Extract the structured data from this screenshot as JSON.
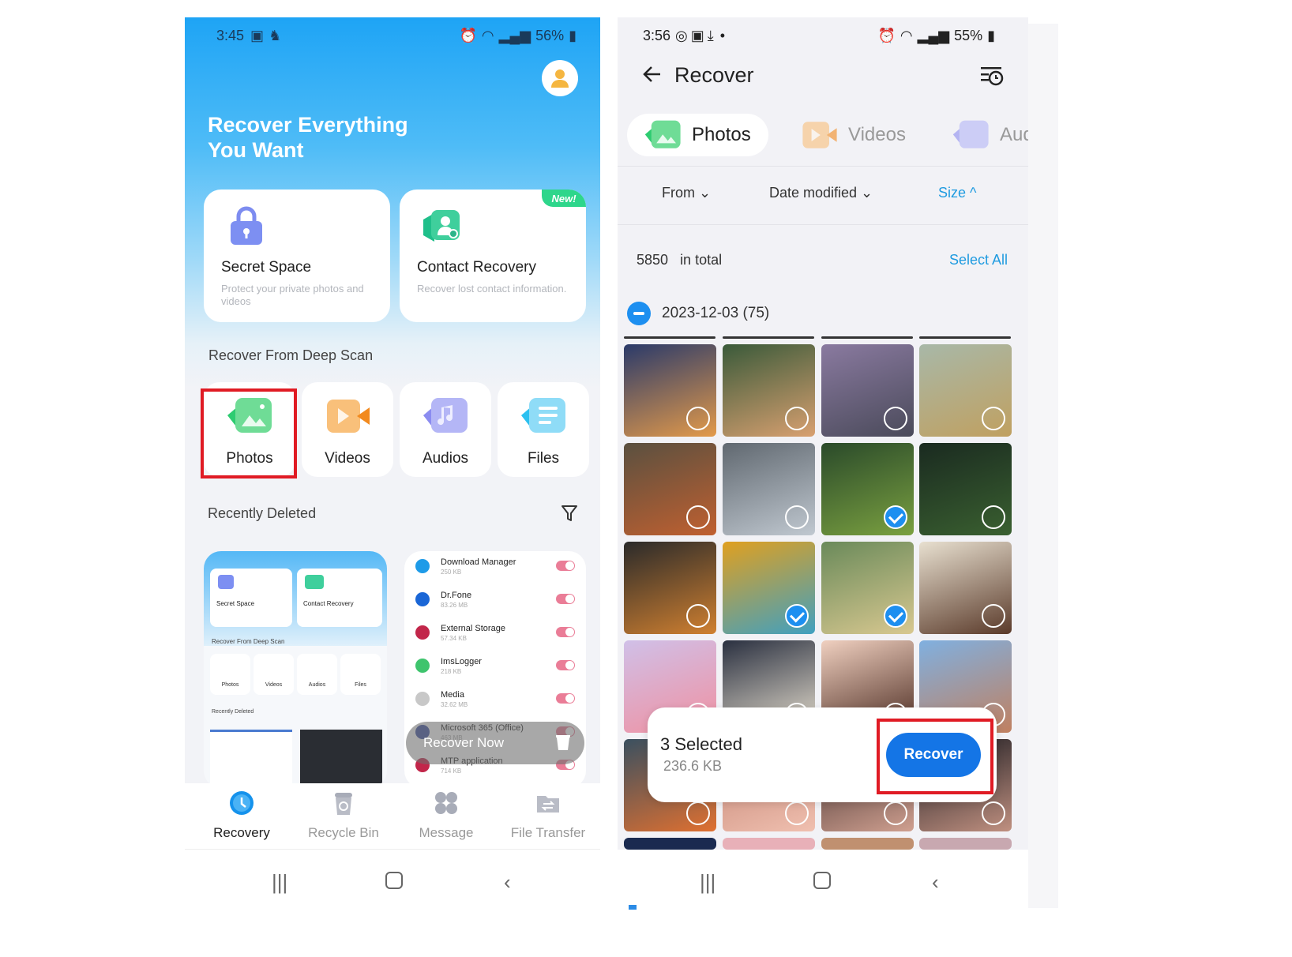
{
  "left_screen": {
    "status_bar": {
      "time": "3:45",
      "battery": "56%",
      "icons": [
        "image-icon",
        "notification-icon",
        "alarm-icon",
        "wifi-icon",
        "volte-icon",
        "signal-icon",
        "battery-icon"
      ]
    },
    "hero_title_line1": "Recover Everything",
    "hero_title_line2": "You Want",
    "feature_cards": [
      {
        "title": "Secret Space",
        "desc": "Protect your private photos and videos",
        "icon": "lock-icon"
      },
      {
        "title": "Contact Recovery",
        "desc": "Recover lost contact information.",
        "icon": "contact-icon",
        "badge": "New!"
      }
    ],
    "deep_scan_title": "Recover From Deep Scan",
    "deep_scan_items": [
      {
        "label": "Photos",
        "icon": "photo-icon",
        "highlighted": true
      },
      {
        "label": "Videos",
        "icon": "video-icon"
      },
      {
        "label": "Audios",
        "icon": "audio-icon"
      },
      {
        "label": "Files",
        "icon": "file-icon"
      }
    ],
    "recently_deleted_title": "Recently Deleted",
    "recent_thumb_left": {
      "mini_cards": [
        "Secret Space",
        "Contact Recovery"
      ],
      "mini_section": "Recover From Deep Scan",
      "mini_items": [
        "Photos",
        "Videos",
        "Audios",
        "Files"
      ],
      "mini_recent": "Recently Deleted"
    },
    "recent_apps": [
      {
        "name": "Download Manager",
        "size": "250 KB",
        "color": "#1e9be8"
      },
      {
        "name": "Dr.Fone",
        "size": "83.26 MB",
        "color": "#1a66d6"
      },
      {
        "name": "External Storage",
        "size": "57.34 KB",
        "color": "#c2264a"
      },
      {
        "name": "ImsLogger",
        "size": "218 KB",
        "color": "#3ec46d"
      },
      {
        "name": "Media",
        "size": "32.62 MB",
        "color": "#c8c8c8"
      },
      {
        "name": "Microsoft 365 (Office)",
        "size": "463 MB",
        "color": "#3a4fa0"
      },
      {
        "name": "MTP application",
        "size": "714 KB",
        "color": "#c2264a"
      }
    ],
    "recover_now": "Recover Now",
    "bottom_nav": [
      {
        "label": "Recovery",
        "active": true
      },
      {
        "label": "Recycle Bin"
      },
      {
        "label": "Message"
      },
      {
        "label": "File Transfer"
      }
    ]
  },
  "right_screen": {
    "status_bar": {
      "time": "3:56",
      "battery": "55%"
    },
    "title": "Recover",
    "tabs": [
      {
        "label": "Photos",
        "active": true
      },
      {
        "label": "Videos"
      },
      {
        "label": "Aud"
      }
    ],
    "sort": {
      "from": "From ⌄",
      "date": "Date modified ⌄",
      "size": "Size ^"
    },
    "total_count": "5850",
    "total_label": "in total",
    "select_all": "Select All",
    "date_group": "2023-12-03 (75)",
    "photos": [
      {
        "selected": false,
        "colors": [
          "#2a3a6a",
          "#e39a4a"
        ]
      },
      {
        "selected": false,
        "colors": [
          "#3a5a3a",
          "#d8a070"
        ]
      },
      {
        "selected": false,
        "colors": [
          "#8a7aa0",
          "#4a4a5a"
        ]
      },
      {
        "selected": false,
        "colors": [
          "#a8b8a8",
          "#c0a060"
        ]
      },
      {
        "selected": false,
        "colors": [
          "#5a5040",
          "#c06030"
        ]
      },
      {
        "selected": false,
        "colors": [
          "#606870",
          "#c0c8d0"
        ]
      },
      {
        "selected": true,
        "colors": [
          "#2a4a2a",
          "#7aa040"
        ]
      },
      {
        "selected": false,
        "colors": [
          "#1a2a20",
          "#3a6030"
        ]
      },
      {
        "selected": false,
        "colors": [
          "#2a2a2a",
          "#d08030"
        ]
      },
      {
        "selected": true,
        "colors": [
          "#e0a020",
          "#40a0c0"
        ]
      },
      {
        "selected": true,
        "colors": [
          "#6a8a5a",
          "#d8c890"
        ]
      },
      {
        "selected": false,
        "colors": [
          "#e8e0d0",
          "#5a3a2a"
        ]
      },
      {
        "selected": false,
        "colors": [
          "#d0c0e8",
          "#f090a0"
        ]
      },
      {
        "selected": false,
        "colors": [
          "#2a3040",
          "#e8e0d0"
        ]
      },
      {
        "selected": false,
        "colors": [
          "#f0d0c0",
          "#4a2a20"
        ]
      },
      {
        "selected": false,
        "colors": [
          "#80b0e0",
          "#c08060"
        ]
      },
      {
        "selected": false,
        "colors": [
          "#3a5060",
          "#e07030"
        ]
      },
      {
        "selected": false,
        "colors": [
          "#c08070",
          "#f0c0b0"
        ]
      },
      {
        "selected": false,
        "colors": [
          "#3a2a2a",
          "#d0a090"
        ]
      },
      {
        "selected": false,
        "colors": [
          "#1a1a20",
          "#c09080"
        ]
      }
    ],
    "selection": {
      "count": "3 Selected",
      "size": "236.6 KB",
      "button": "Recover"
    }
  }
}
